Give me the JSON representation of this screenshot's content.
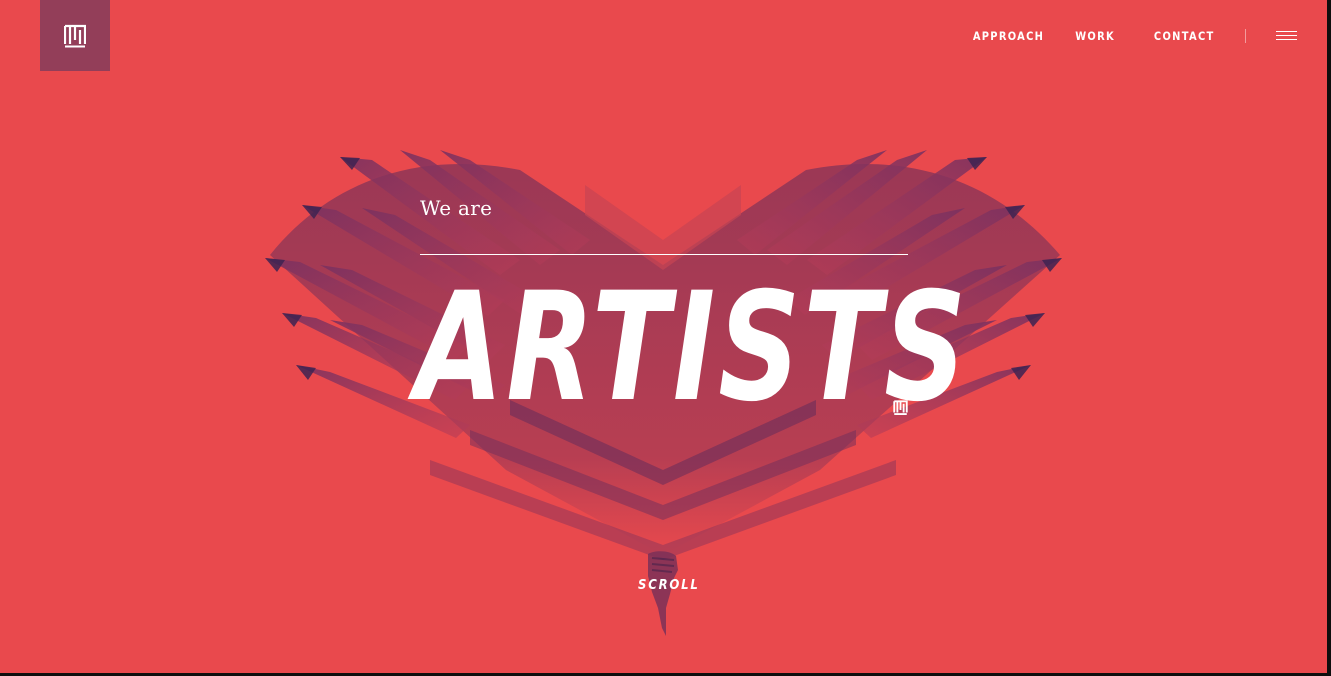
{
  "colors": {
    "background": "#e9494d",
    "logo_block": "#933e59",
    "art_dark": "#5b2a5c",
    "text": "#ffffff"
  },
  "header": {
    "logo_icon": "brand-monogram-icon",
    "nav": {
      "approach": "APPROACH",
      "work": "WORK",
      "contact": "CONTACT"
    },
    "menu_icon": "hamburger-menu-icon"
  },
  "hero": {
    "kicker": "We are",
    "headline": "ARTISTS",
    "badge_icon": "brand-monogram-icon",
    "art_description_icon": "pencil-heart-art"
  },
  "scroll": {
    "label": "SCROLL",
    "icon": "pointing-hand-icon"
  }
}
